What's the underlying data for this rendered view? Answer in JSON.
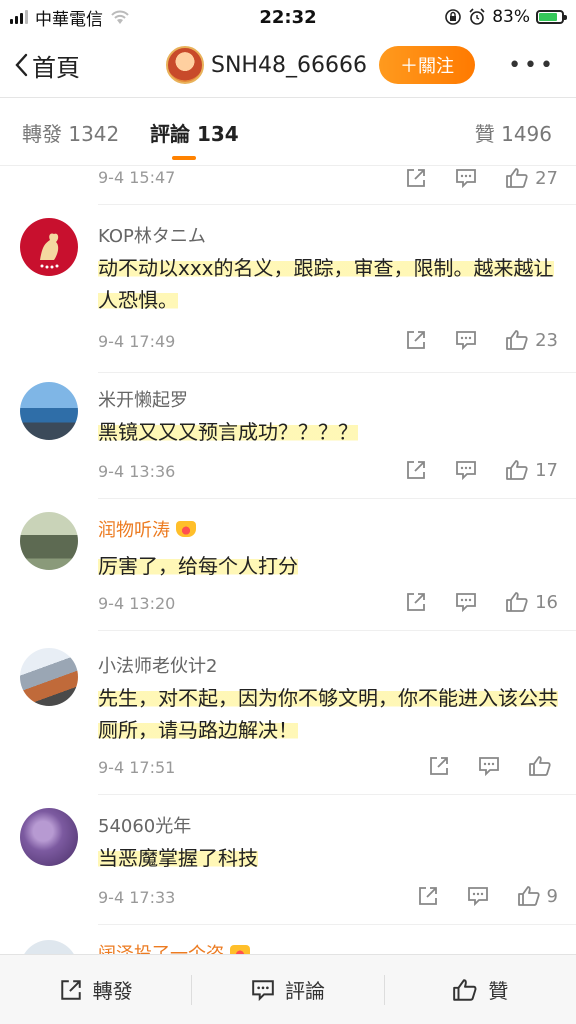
{
  "status": {
    "carrier": "中華電信",
    "time": "22:32",
    "battery": "83%",
    "battery_level": 0.83
  },
  "nav": {
    "back_label": "首頁",
    "username": "SNH48_66666",
    "follow_label": "＋關注",
    "more_label": "•••"
  },
  "tabs": [
    {
      "label": "轉發 1342"
    },
    {
      "label": "評論 134"
    },
    {
      "label": "贊 1496"
    }
  ],
  "comments": [
    {
      "name": "",
      "text": "",
      "time": "9-4 15:47",
      "likes": "27"
    },
    {
      "name": "KOP林タニム",
      "text": "动不动以xxx的名义，跟踪，审查，限制。越来越让人恐惧。",
      "time": "9-4 17:49",
      "likes": "23"
    },
    {
      "name": "米开懒起罗",
      "text": "黑镜又又又预言成功？？？？",
      "time": "9-4 13:36",
      "likes": "17"
    },
    {
      "name": "润物听涛",
      "text": "厉害了，给每个人打分",
      "time": "9-4 13:20",
      "likes": "16"
    },
    {
      "name": "小法师老伙计2",
      "text": "先生，对不起，因为你不够文明，你不能进入该公共厕所，请马路边解决！",
      "time": "9-4 17:51",
      "likes": ""
    },
    {
      "name": "54060光年",
      "text": "当恶魔掌握了科技",
      "time": "9-4 17:33",
      "likes": "9"
    },
    {
      "name": "阔泽投了一个盗",
      "text": "",
      "time": "",
      "likes": ""
    }
  ],
  "bottom": {
    "repost": "轉發",
    "comment": "評論",
    "like": "贊"
  },
  "colors": {
    "accent": "#ff8200",
    "vip_name": "#ec7b21",
    "highlight": "#fff6aa"
  }
}
